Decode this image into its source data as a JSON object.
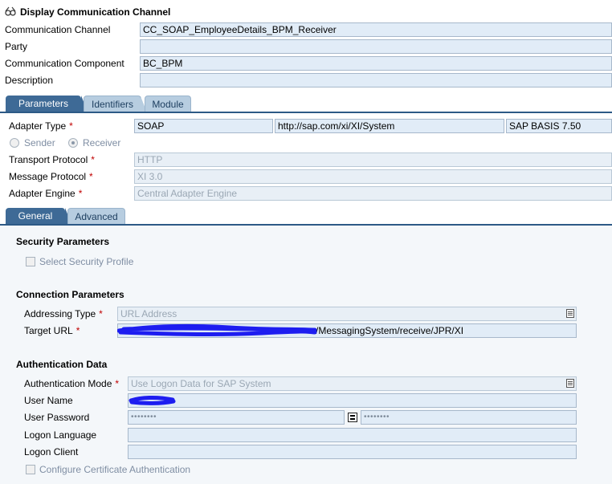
{
  "window": {
    "title": "Display Communication Channel",
    "icon": "glasses-icon"
  },
  "header": {
    "channel_label": "Communication Channel",
    "channel_value": "CC_SOAP_EmployeeDetails_BPM_Receiver",
    "party_label": "Party",
    "party_value": "",
    "component_label": "Communication Component",
    "component_value": "BC_BPM",
    "description_label": "Description",
    "description_value": ""
  },
  "main_tabs": [
    {
      "label": "Parameters",
      "active": true
    },
    {
      "label": "Identifiers",
      "active": false
    },
    {
      "label": "Module",
      "active": false
    }
  ],
  "parameters": {
    "adapter_type_label": "Adapter Type",
    "adapter_type": "SOAP",
    "adapter_namespace": "http://sap.com/xi/XI/System",
    "adapter_version": "SAP BASIS 7.50",
    "sender_label": "Sender",
    "receiver_label": "Receiver",
    "selected_direction": "Receiver",
    "transport_protocol_label": "Transport Protocol",
    "transport_protocol": "HTTP",
    "message_protocol_label": "Message Protocol",
    "message_protocol": "XI 3.0",
    "adapter_engine_label": "Adapter Engine",
    "adapter_engine": "Central Adapter Engine"
  },
  "sub_tabs": [
    {
      "label": "General",
      "active": true
    },
    {
      "label": "Advanced",
      "active": false
    }
  ],
  "security": {
    "title": "Security Parameters",
    "select_profile_label": "Select Security Profile",
    "select_profile_checked": false
  },
  "connection": {
    "title": "Connection Parameters",
    "addressing_type_label": "Addressing Type",
    "addressing_type": "URL Address",
    "target_url_label": "Target URL",
    "target_url_suffix": "/MessagingSystem/receive/JPR/XI"
  },
  "authentication": {
    "title": "Authentication Data",
    "mode_label": "Authentication Mode",
    "mode_value": "Use Logon Data for SAP System",
    "user_name_label": "User Name",
    "user_password_label": "User Password",
    "password_mask": "••••••••",
    "password_confirm_mask": "••••••••",
    "logon_language_label": "Logon Language",
    "logon_language": "",
    "logon_client_label": "Logon Client",
    "logon_client": "",
    "cert_auth_label": "Configure Certificate Authentication",
    "cert_auth_checked": false
  },
  "colors": {
    "tab_active": "#3e6a96",
    "tab_inactive": "#b7cde0",
    "field_bg": "#e1ecf7",
    "required_marker": "#c00000",
    "redaction": "#1d1df0"
  }
}
